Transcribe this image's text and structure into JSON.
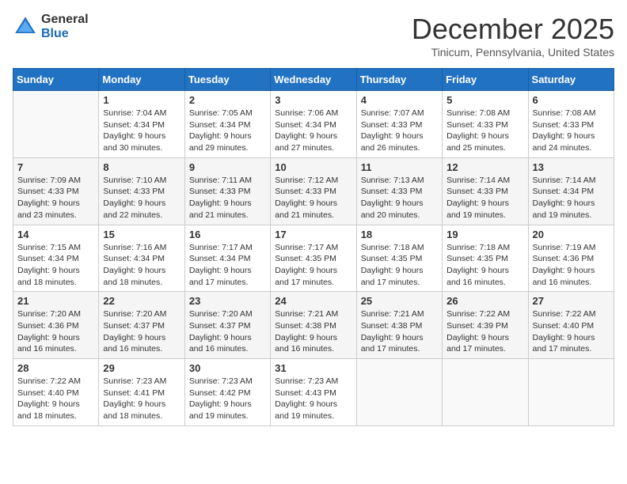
{
  "header": {
    "logo_general": "General",
    "logo_blue": "Blue",
    "month_title": "December 2025",
    "location": "Tinicum, Pennsylvania, United States"
  },
  "days_of_week": [
    "Sunday",
    "Monday",
    "Tuesday",
    "Wednesday",
    "Thursday",
    "Friday",
    "Saturday"
  ],
  "weeks": [
    [
      {
        "day": "",
        "sunrise": "",
        "sunset": "",
        "daylight": ""
      },
      {
        "day": "1",
        "sunrise": "Sunrise: 7:04 AM",
        "sunset": "Sunset: 4:34 PM",
        "daylight": "Daylight: 9 hours and 30 minutes."
      },
      {
        "day": "2",
        "sunrise": "Sunrise: 7:05 AM",
        "sunset": "Sunset: 4:34 PM",
        "daylight": "Daylight: 9 hours and 29 minutes."
      },
      {
        "day": "3",
        "sunrise": "Sunrise: 7:06 AM",
        "sunset": "Sunset: 4:34 PM",
        "daylight": "Daylight: 9 hours and 27 minutes."
      },
      {
        "day": "4",
        "sunrise": "Sunrise: 7:07 AM",
        "sunset": "Sunset: 4:33 PM",
        "daylight": "Daylight: 9 hours and 26 minutes."
      },
      {
        "day": "5",
        "sunrise": "Sunrise: 7:08 AM",
        "sunset": "Sunset: 4:33 PM",
        "daylight": "Daylight: 9 hours and 25 minutes."
      },
      {
        "day": "6",
        "sunrise": "Sunrise: 7:08 AM",
        "sunset": "Sunset: 4:33 PM",
        "daylight": "Daylight: 9 hours and 24 minutes."
      }
    ],
    [
      {
        "day": "7",
        "sunrise": "Sunrise: 7:09 AM",
        "sunset": "Sunset: 4:33 PM",
        "daylight": "Daylight: 9 hours and 23 minutes."
      },
      {
        "day": "8",
        "sunrise": "Sunrise: 7:10 AM",
        "sunset": "Sunset: 4:33 PM",
        "daylight": "Daylight: 9 hours and 22 minutes."
      },
      {
        "day": "9",
        "sunrise": "Sunrise: 7:11 AM",
        "sunset": "Sunset: 4:33 PM",
        "daylight": "Daylight: 9 hours and 21 minutes."
      },
      {
        "day": "10",
        "sunrise": "Sunrise: 7:12 AM",
        "sunset": "Sunset: 4:33 PM",
        "daylight": "Daylight: 9 hours and 21 minutes."
      },
      {
        "day": "11",
        "sunrise": "Sunrise: 7:13 AM",
        "sunset": "Sunset: 4:33 PM",
        "daylight": "Daylight: 9 hours and 20 minutes."
      },
      {
        "day": "12",
        "sunrise": "Sunrise: 7:14 AM",
        "sunset": "Sunset: 4:33 PM",
        "daylight": "Daylight: 9 hours and 19 minutes."
      },
      {
        "day": "13",
        "sunrise": "Sunrise: 7:14 AM",
        "sunset": "Sunset: 4:34 PM",
        "daylight": "Daylight: 9 hours and 19 minutes."
      }
    ],
    [
      {
        "day": "14",
        "sunrise": "Sunrise: 7:15 AM",
        "sunset": "Sunset: 4:34 PM",
        "daylight": "Daylight: 9 hours and 18 minutes."
      },
      {
        "day": "15",
        "sunrise": "Sunrise: 7:16 AM",
        "sunset": "Sunset: 4:34 PM",
        "daylight": "Daylight: 9 hours and 18 minutes."
      },
      {
        "day": "16",
        "sunrise": "Sunrise: 7:17 AM",
        "sunset": "Sunset: 4:34 PM",
        "daylight": "Daylight: 9 hours and 17 minutes."
      },
      {
        "day": "17",
        "sunrise": "Sunrise: 7:17 AM",
        "sunset": "Sunset: 4:35 PM",
        "daylight": "Daylight: 9 hours and 17 minutes."
      },
      {
        "day": "18",
        "sunrise": "Sunrise: 7:18 AM",
        "sunset": "Sunset: 4:35 PM",
        "daylight": "Daylight: 9 hours and 17 minutes."
      },
      {
        "day": "19",
        "sunrise": "Sunrise: 7:18 AM",
        "sunset": "Sunset: 4:35 PM",
        "daylight": "Daylight: 9 hours and 16 minutes."
      },
      {
        "day": "20",
        "sunrise": "Sunrise: 7:19 AM",
        "sunset": "Sunset: 4:36 PM",
        "daylight": "Daylight: 9 hours and 16 minutes."
      }
    ],
    [
      {
        "day": "21",
        "sunrise": "Sunrise: 7:20 AM",
        "sunset": "Sunset: 4:36 PM",
        "daylight": "Daylight: 9 hours and 16 minutes."
      },
      {
        "day": "22",
        "sunrise": "Sunrise: 7:20 AM",
        "sunset": "Sunset: 4:37 PM",
        "daylight": "Daylight: 9 hours and 16 minutes."
      },
      {
        "day": "23",
        "sunrise": "Sunrise: 7:20 AM",
        "sunset": "Sunset: 4:37 PM",
        "daylight": "Daylight: 9 hours and 16 minutes."
      },
      {
        "day": "24",
        "sunrise": "Sunrise: 7:21 AM",
        "sunset": "Sunset: 4:38 PM",
        "daylight": "Daylight: 9 hours and 16 minutes."
      },
      {
        "day": "25",
        "sunrise": "Sunrise: 7:21 AM",
        "sunset": "Sunset: 4:38 PM",
        "daylight": "Daylight: 9 hours and 17 minutes."
      },
      {
        "day": "26",
        "sunrise": "Sunrise: 7:22 AM",
        "sunset": "Sunset: 4:39 PM",
        "daylight": "Daylight: 9 hours and 17 minutes."
      },
      {
        "day": "27",
        "sunrise": "Sunrise: 7:22 AM",
        "sunset": "Sunset: 4:40 PM",
        "daylight": "Daylight: 9 hours and 17 minutes."
      }
    ],
    [
      {
        "day": "28",
        "sunrise": "Sunrise: 7:22 AM",
        "sunset": "Sunset: 4:40 PM",
        "daylight": "Daylight: 9 hours and 18 minutes."
      },
      {
        "day": "29",
        "sunrise": "Sunrise: 7:23 AM",
        "sunset": "Sunset: 4:41 PM",
        "daylight": "Daylight: 9 hours and 18 minutes."
      },
      {
        "day": "30",
        "sunrise": "Sunrise: 7:23 AM",
        "sunset": "Sunset: 4:42 PM",
        "daylight": "Daylight: 9 hours and 19 minutes."
      },
      {
        "day": "31",
        "sunrise": "Sunrise: 7:23 AM",
        "sunset": "Sunset: 4:43 PM",
        "daylight": "Daylight: 9 hours and 19 minutes."
      },
      {
        "day": "",
        "sunrise": "",
        "sunset": "",
        "daylight": ""
      },
      {
        "day": "",
        "sunrise": "",
        "sunset": "",
        "daylight": ""
      },
      {
        "day": "",
        "sunrise": "",
        "sunset": "",
        "daylight": ""
      }
    ]
  ]
}
